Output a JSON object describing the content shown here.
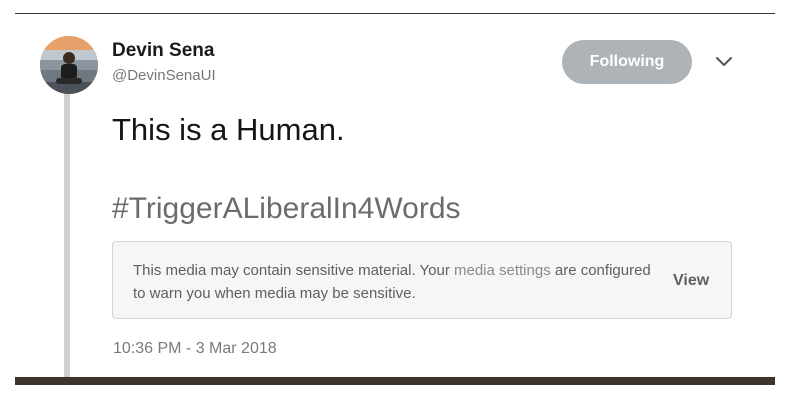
{
  "tweet": {
    "author_name": "Devin Sena",
    "author_handle": "@DevinSenaUI",
    "follow_button_label": "Following",
    "text": "This is a Human.",
    "hashtag": "#TriggerALiberalIn4Words",
    "sensitive_notice": {
      "text_before_link": "This media may contain sensitive material. Your ",
      "link_text": "media settings",
      "text_after_link": " are configured to warn you when media may be sensitive.",
      "view_label": "View"
    },
    "timestamp": "10:36 PM - 3 Mar 2018"
  },
  "icons": {
    "menu": "chevron-down-icon",
    "avatar": "avatar"
  },
  "colors": {
    "follow_button_bg": "#aeb3b7",
    "warning_box_bg": "#f5f6f7",
    "thread_line": "#cfcfcf"
  }
}
